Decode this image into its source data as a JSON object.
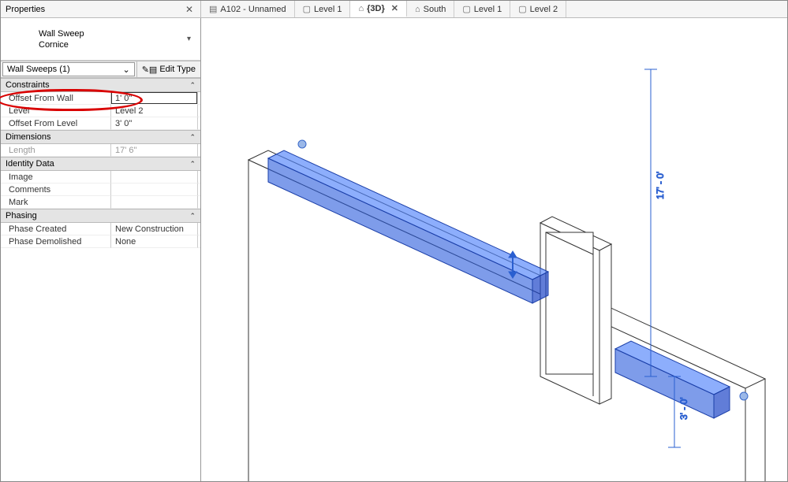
{
  "panel": {
    "title": "Properties"
  },
  "tabs": [
    {
      "icon": "sheet",
      "label": "A102 - Unnamed",
      "active": false,
      "closable": false
    },
    {
      "icon": "plan",
      "label": "Level 1",
      "active": false,
      "closable": false
    },
    {
      "icon": "cube",
      "label": "{3D}",
      "active": true,
      "closable": true
    },
    {
      "icon": "elev",
      "label": "South",
      "active": false,
      "closable": false
    },
    {
      "icon": "plan",
      "label": "Level 1",
      "active": false,
      "closable": false
    },
    {
      "icon": "plan",
      "label": "Level 2",
      "active": false,
      "closable": false
    }
  ],
  "type_selector": {
    "family": "Wall Sweep",
    "type": "Cornice"
  },
  "instance_filter": {
    "label": "Wall Sweeps (1)"
  },
  "edit_type_label": "Edit Type",
  "groups": {
    "constraints": {
      "header": "Constraints",
      "offset_from_wall": {
        "label": "Offset From Wall",
        "value": "1'   0\""
      },
      "level": {
        "label": "Level",
        "value": "Level 2"
      },
      "offset_from_level": {
        "label": "Offset From Level",
        "value": "3'   0\""
      }
    },
    "dimensions": {
      "header": "Dimensions",
      "length": {
        "label": "Length",
        "value": "17'   6\""
      }
    },
    "identity": {
      "header": "Identity Data",
      "image": {
        "label": "Image",
        "value": ""
      },
      "comments": {
        "label": "Comments",
        "value": ""
      },
      "mark": {
        "label": "Mark",
        "value": ""
      }
    },
    "phasing": {
      "header": "Phasing",
      "created": {
        "label": "Phase Created",
        "value": "New Construction"
      },
      "demolished": {
        "label": "Phase Demolished",
        "value": "None"
      }
    }
  },
  "viewport": {
    "dim_label_height": "17' - 0'",
    "dim_label_offset": "3' - 0'"
  }
}
